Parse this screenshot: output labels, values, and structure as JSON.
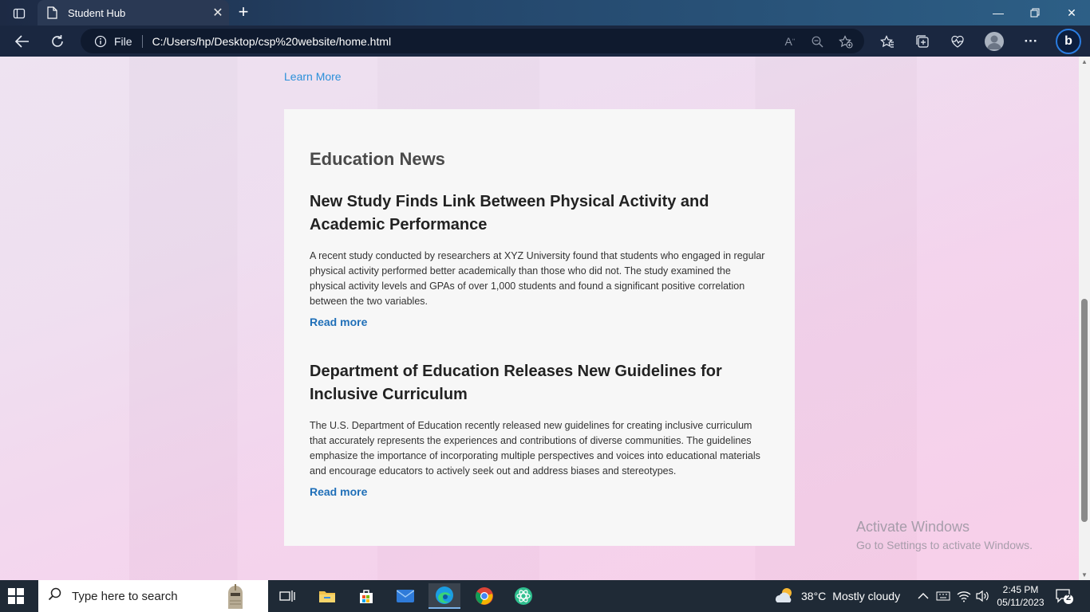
{
  "browser": {
    "tab_title": "Student Hub",
    "address_prefix": "File",
    "url": "C:/Users/hp/Desktop/csp%20website/home.html"
  },
  "page": {
    "learn_more": "Learn More",
    "section_title": "Education News",
    "articles": [
      {
        "title": "New Study Finds Link Between Physical Activity and Academic Performance",
        "body": "A recent study conducted by researchers at XYZ University found that students who engaged in regular physical activity performed better academically than those who did not. The study examined the physical activity levels and GPAs of over 1,000 students and found a significant positive correlation between the two variables.",
        "link": "Read more"
      },
      {
        "title": "Department of Education Releases New Guidelines for Inclusive Curriculum",
        "body": "The U.S. Department of Education recently released new guidelines for creating inclusive curriculum that accurately represents the experiences and contributions of diverse communities. The guidelines emphasize the importance of incorporating multiple perspectives and voices into educational materials and encourage educators to actively seek out and address biases and stereotypes.",
        "link": "Read more"
      }
    ]
  },
  "watermark": {
    "line1": "Activate Windows",
    "line2": "Go to Settings to activate Windows."
  },
  "taskbar": {
    "search_placeholder": "Type here to search",
    "weather_temp": "38°C",
    "weather_text": "Mostly cloudy",
    "time": "2:45 PM",
    "date": "05/11/2023",
    "notification_count": "2"
  },
  "colors": {
    "link": "#2b90d9",
    "read_more": "#1f6fb8",
    "card_bg": "#f7f7f7"
  }
}
